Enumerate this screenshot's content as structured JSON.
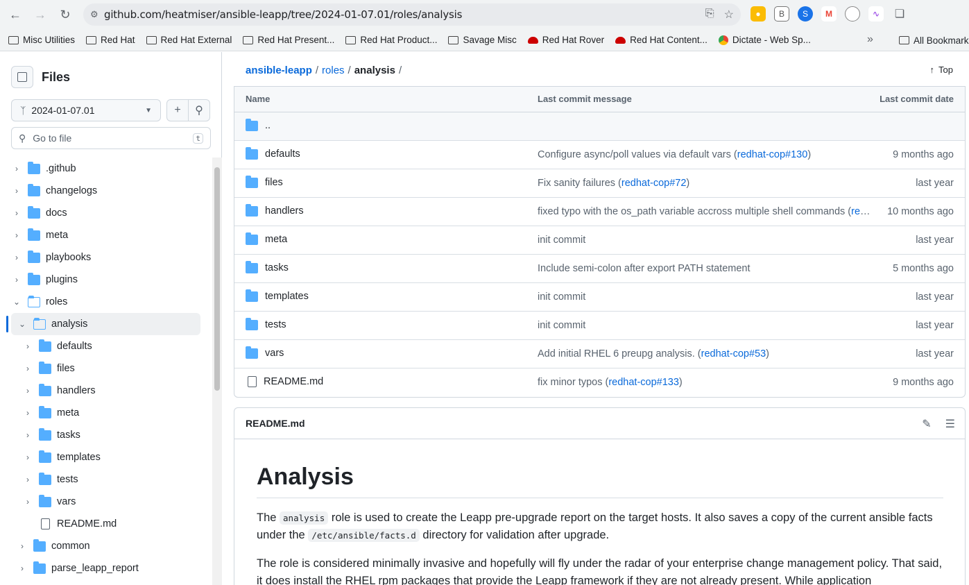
{
  "browser": {
    "url": "github.com/heatmiser/ansible-leapp/tree/2024-01-07.01/roles/analysis",
    "bookmarks": [
      "Misc Utilities",
      "Red Hat",
      "Red Hat External",
      "Red Hat Present...",
      "Red Hat Product...",
      "Savage Misc",
      "Red Hat Rover",
      "Red Hat Content...",
      "Dictate - Web Sp..."
    ],
    "all_bookmarks": "All Bookmarks"
  },
  "sidebar": {
    "title": "Files",
    "branch": "2024-01-07.01",
    "go_to_file_placeholder": "Go to file",
    "go_to_file_key": "t",
    "tree": [
      {
        "label": ".github"
      },
      {
        "label": "changelogs"
      },
      {
        "label": "docs"
      },
      {
        "label": "meta"
      },
      {
        "label": "playbooks"
      },
      {
        "label": "plugins"
      },
      {
        "label": "roles"
      },
      {
        "label": "analysis"
      },
      {
        "label": "defaults"
      },
      {
        "label": "files"
      },
      {
        "label": "handlers"
      },
      {
        "label": "meta"
      },
      {
        "label": "tasks"
      },
      {
        "label": "templates"
      },
      {
        "label": "tests"
      },
      {
        "label": "vars"
      },
      {
        "label": "README.md"
      },
      {
        "label": "common"
      },
      {
        "label": "parse_leapp_report"
      }
    ]
  },
  "breadcrumb": {
    "repo": "ansible-leapp",
    "dir": "roles",
    "current": "analysis",
    "sep": "/",
    "top": "Top"
  },
  "table": {
    "headers": {
      "name": "Name",
      "message": "Last commit message",
      "date": "Last commit date"
    },
    "parent": "..",
    "rows": [
      {
        "name": "defaults",
        "msg": "Configure async/poll values via default vars (",
        "link": "redhat-cop#130",
        "tail": ")",
        "date": "9 months ago"
      },
      {
        "name": "files",
        "msg": "Fix sanity failures (",
        "link": "redhat-cop#72",
        "tail": ")",
        "date": "last year"
      },
      {
        "name": "handlers",
        "msg": "fixed typo with the os_path variable accross multiple shell commands (",
        "link": "redhat-cop#",
        "tail": "",
        "date": "10 months ago"
      },
      {
        "name": "meta",
        "msg": "init commit",
        "link": "",
        "tail": "",
        "date": "last year"
      },
      {
        "name": "tasks",
        "msg": "Include semi-colon after export PATH statement",
        "link": "",
        "tail": "",
        "date": "5 months ago"
      },
      {
        "name": "templates",
        "msg": "init commit",
        "link": "",
        "tail": "",
        "date": "last year"
      },
      {
        "name": "tests",
        "msg": "init commit",
        "link": "",
        "tail": "",
        "date": "last year"
      },
      {
        "name": "vars",
        "msg": "Add initial RHEL 6 preupg analysis. (",
        "link": "redhat-cop#53",
        "tail": ")",
        "date": "last year"
      },
      {
        "name": "README.md",
        "msg": "fix minor typos (",
        "link": "redhat-cop#133",
        "tail": ")",
        "date": "9 months ago"
      }
    ]
  },
  "readme": {
    "file": "README.md",
    "h1": "Analysis",
    "p1_a": "The ",
    "p1_code1": "analysis",
    "p1_b": " role is used to create the Leapp pre-upgrade report on the target hosts. It also saves a copy of the current ansible facts under the ",
    "p1_code2": "/etc/ansible/facts.d",
    "p1_c": " directory for validation after upgrade.",
    "p2": "The role is considered minimally invasive and hopefully will fly under the radar of your enterprise change management policy. That said, it does install the RHEL rpm packages that provide the Leapp framework if they are not already present. While application"
  }
}
